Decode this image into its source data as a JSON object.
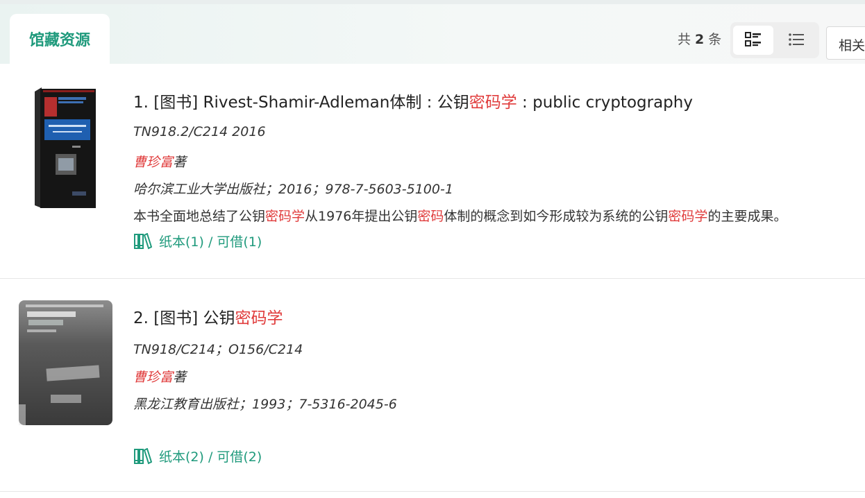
{
  "tabs": {
    "active_label": "馆藏资源"
  },
  "results": {
    "count_prefix": "共",
    "count": "2",
    "count_suffix": "条"
  },
  "sort": {
    "label": "相关"
  },
  "records": [
    {
      "index": "1.",
      "type": "[图书]",
      "title_before": "Rivest-Shamir-Adleman体制 : 公钥",
      "title_highlight": "密码学",
      "title_after": " : public cryptography",
      "call_number": "TN918.2/C214 2016",
      "author": "曹珍富",
      "author_role": "著",
      "publisher_line": "哈尔滨工业大学出版社；2016；978-7-5603-5100-1",
      "summary": [
        {
          "text": "本书全面地总结了公钥",
          "hl": false
        },
        {
          "text": "密码学",
          "hl": true
        },
        {
          "text": "从1976年提出公钥",
          "hl": false
        },
        {
          "text": "密码",
          "hl": true
        },
        {
          "text": "体制的概念到如今形成较为系统的公钥",
          "hl": false
        },
        {
          "text": "密码学",
          "hl": true
        },
        {
          "text": "的主要成果。",
          "hl": false
        }
      ],
      "holdings": "纸本(1) / 可借(1)"
    },
    {
      "index": "2.",
      "type": "[图书]",
      "title_before": "公钥",
      "title_highlight": "密码学",
      "title_after": "",
      "call_number": "TN918/C214；O156/C214",
      "author": "曹珍富",
      "author_role": "著",
      "publisher_line": "黑龙江教育出版社；1993；7-5316-2045-6",
      "holdings": "纸本(2) / 可借(2)"
    }
  ],
  "icons": {
    "grid_view": "detail-view-icon",
    "list_view": "list-view-icon",
    "holdings": "books-icon"
  },
  "colors": {
    "accent": "#1f9a7c",
    "highlight": "#e03b3b"
  }
}
